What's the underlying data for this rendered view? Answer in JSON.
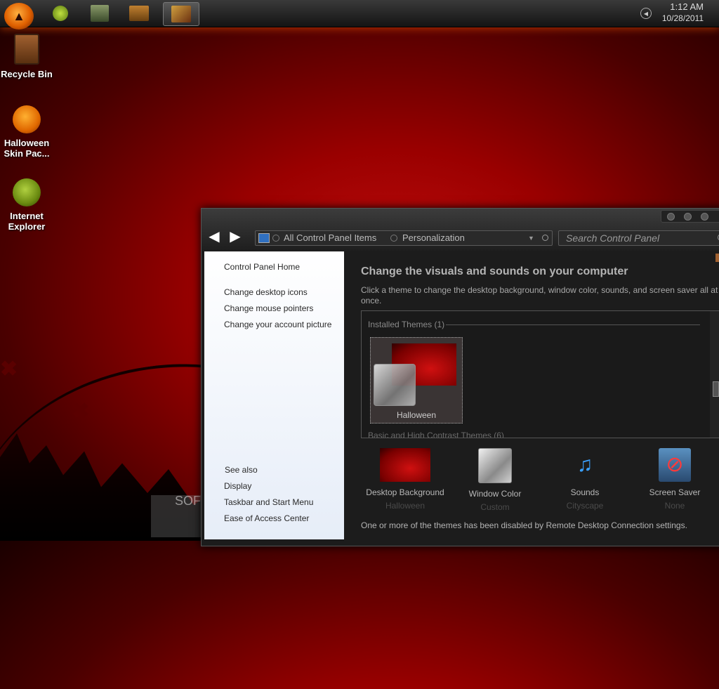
{
  "taskbar": {
    "clock_time": "1:12 AM",
    "clock_date": "10/28/2011",
    "buttons": [
      "ie-icon",
      "explorer-icon",
      "folder-icon",
      "control-panel-icon"
    ]
  },
  "desktop": {
    "icons": [
      {
        "label": "Recycle Bin"
      },
      {
        "label": "Halloween Skin Pac..."
      },
      {
        "label": "Internet Explorer"
      }
    ]
  },
  "watermark": "SOFTPEDIA",
  "window": {
    "address": {
      "crumb1": "All Control Panel Items",
      "crumb2": "Personalization"
    },
    "search_placeholder": "Search Control Panel",
    "sidebar": {
      "home": "Control Panel Home",
      "links": [
        "Change desktop icons",
        "Change mouse pointers",
        "Change your account picture"
      ],
      "see_also": "See also",
      "see_also_links": [
        "Display",
        "Taskbar and Start Menu",
        "Ease of Access Center"
      ]
    },
    "main": {
      "title": "Change the visuals and sounds on your computer",
      "description": "Click a theme to change the desktop background, window color, sounds, and screen saver all at once.",
      "installed_group": "Installed Themes (1)",
      "theme_name": "Halloween",
      "basic_group": "Basic and High Contrast Themes (6)",
      "options": [
        {
          "label": "Desktop Background",
          "sub": "Halloween"
        },
        {
          "label": "Window Color",
          "sub": "Custom"
        },
        {
          "label": "Sounds",
          "sub": "Cityscape"
        },
        {
          "label": "Screen Saver",
          "sub": "None"
        }
      ],
      "note": "One or more of the themes has been disabled by Remote Desktop Connection settings."
    }
  }
}
